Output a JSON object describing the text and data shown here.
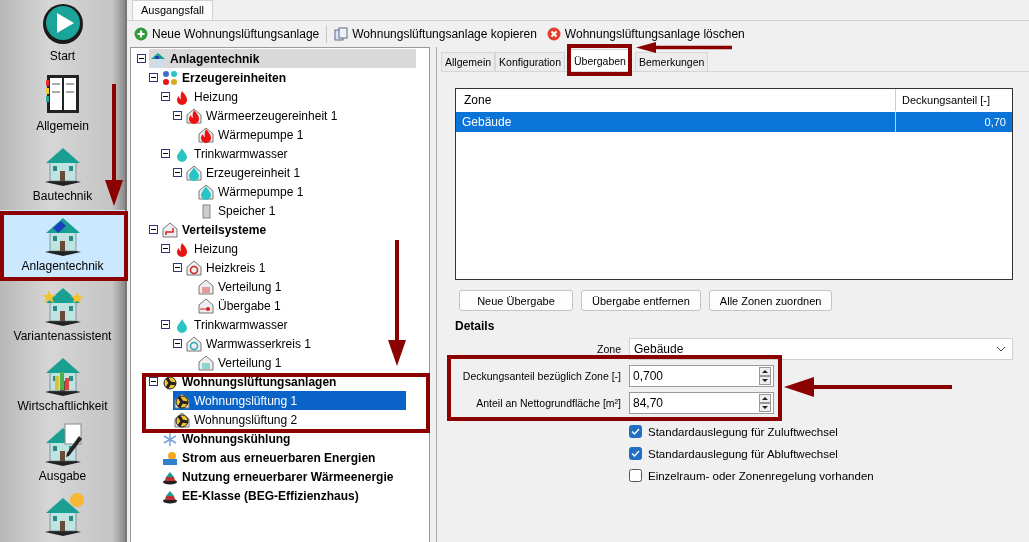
{
  "sidebar": {
    "items": [
      {
        "label": "Start",
        "kind": "play",
        "selected": false
      },
      {
        "label": "Allgemein",
        "kind": "book",
        "selected": false
      },
      {
        "label": "Bautechnik",
        "kind": "house",
        "selected": false
      },
      {
        "label": "Anlagentechnik",
        "kind": "solar",
        "selected": true
      },
      {
        "label": "Variantenassistent",
        "kind": "stars",
        "selected": false
      },
      {
        "label": "Wirtschaftlichkeit",
        "kind": "chart",
        "selected": false
      },
      {
        "label": "Ausgabe",
        "kind": "pen",
        "selected": false
      },
      {
        "kind": "sun",
        "selected": false
      }
    ]
  },
  "document_tab": {
    "label": "Ausgangsfall"
  },
  "toolbar": [
    {
      "label": "Neue Wohnungslüftungsanlage",
      "kind": "add"
    },
    {
      "label": "Wohnungslüftungsanlage kopieren",
      "kind": "copy"
    },
    {
      "label": "Wohnungslüftungsanlage löschen",
      "kind": "delete"
    }
  ],
  "tree": {
    "items": [
      {
        "label": "Anlagentechnik",
        "kind": "system",
        "expanded": true,
        "selected": false,
        "children": [
          {
            "label": "Erzeugereinheiten",
            "kind": "mixed",
            "expanded": true,
            "selected": false,
            "children": [
              {
                "label": "Heizung",
                "kind": "flame",
                "expanded": true,
                "selected": false,
                "children": [
                  {
                    "label": "Wärmeerzeugereinheit 1",
                    "kind": "house-flame",
                    "expanded": true,
                    "selected": false,
                    "children": [
                      {
                        "label": "Wärmepumpe 1",
                        "kind": "house-flame",
                        "selected": false
                      }
                    ]
                  }
                ]
              },
              {
                "label": "Trinkwarmwasser",
                "kind": "drop",
                "expanded": true,
                "selected": false,
                "children": [
                  {
                    "label": "Erzeugereinheit 1",
                    "kind": "house-drop",
                    "expanded": true,
                    "selected": false,
                    "children": [
                      {
                        "label": "Wärmepumpe 1",
                        "kind": "house-drop",
                        "selected": false
                      },
                      {
                        "label": "Speicher 1",
                        "kind": "tank",
                        "selected": false
                      }
                    ]
                  }
                ]
              }
            ]
          },
          {
            "label": "Verteilsysteme",
            "kind": "house-pipe",
            "expanded": true,
            "selected": false,
            "children": [
              {
                "label": "Heizung",
                "kind": "flame",
                "expanded": true,
                "selected": false,
                "children": [
                  {
                    "label": "Heizkreis 1",
                    "kind": "house-circuit",
                    "expanded": true,
                    "selected": false,
                    "children": [
                      {
                        "label": "Verteilung 1",
                        "kind": "house-radiator",
                        "selected": false
                      },
                      {
                        "label": "Übergabe 1",
                        "kind": "house-valve",
                        "selected": false
                      }
                    ]
                  }
                ]
              },
              {
                "label": "Trinkwarmwasser",
                "kind": "drop",
                "expanded": true,
                "selected": false,
                "children": [
                  {
                    "label": "Warmwasserkreis 1",
                    "kind": "house-loop",
                    "expanded": true,
                    "selected": false,
                    "children": [
                      {
                        "label": "Verteilung 1",
                        "kind": "house-coil",
                        "selected": false
                      }
                    ]
                  }
                ]
              }
            ]
          },
          {
            "label": "Wohnungslüftungsanlagen",
            "kind": "fan",
            "expanded": true,
            "selected": false,
            "children": [
              {
                "label": "Wohnungslüftung 1",
                "kind": "house-fan",
                "selected": true
              },
              {
                "label": "Wohnungslüftung 2",
                "kind": "house-fan",
                "selected": false
              }
            ]
          },
          {
            "label": "Wohnungskühlung",
            "kind": "snowflake",
            "selected": false
          },
          {
            "label": "Strom aus erneuerbaren Energien",
            "kind": "solar",
            "selected": false
          },
          {
            "label": "Nutzung erneuerbarer Wärmeenergie",
            "kind": "dome",
            "selected": false
          },
          {
            "label": "EE-Klasse (BEG-Effizienzhaus)",
            "kind": "dome",
            "selected": false
          }
        ]
      }
    ]
  },
  "tabs": [
    {
      "label": "Allgemein",
      "selected": false
    },
    {
      "label": "Konfiguration",
      "selected": false
    },
    {
      "label": "Übergaben",
      "selected": true
    },
    {
      "label": "Bemerkungen",
      "selected": false
    }
  ],
  "table": {
    "columns": [
      "Zone",
      "Deckungsanteil [-]"
    ],
    "rows": [
      {
        "zone": "Gebäude",
        "share": "0,70",
        "selected": true
      }
    ]
  },
  "buttons": [
    "Neue Übergabe",
    "Übergabe entfernen",
    "Alle Zonen zuordnen"
  ],
  "details": {
    "title": "Details",
    "zone": {
      "label": "Zone",
      "value": "Gebäude"
    },
    "spin_fields": [
      {
        "label": "Deckungsanteil bezüglich Zone [-]",
        "value": "0,700"
      },
      {
        "label": "Anteil an Nettogrundfläche [m²]",
        "value": "84,70"
      }
    ],
    "checkboxes": [
      {
        "label": "Standardauslegung für Zuluftwechsel",
        "checked": true
      },
      {
        "label": "Standardauslegung für Abluftwechsel",
        "checked": true
      },
      {
        "label": "Einzelraum- oder Zonenregelung vorhanden",
        "checked": false
      }
    ]
  }
}
